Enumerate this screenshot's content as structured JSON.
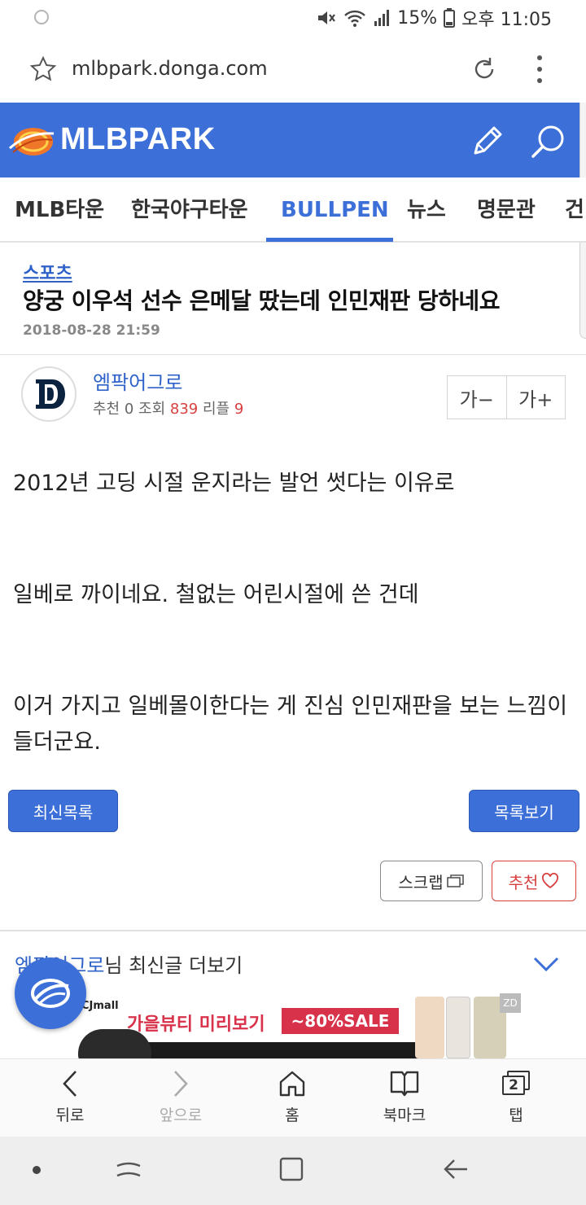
{
  "status_bar": {
    "battery": "15%",
    "time": "오후 11:05"
  },
  "address_bar": {
    "url": "mlbpark.donga.com"
  },
  "site": {
    "logo_text": "MLBPARK"
  },
  "nav_tabs": [
    {
      "label": "MLB타운",
      "active": false
    },
    {
      "label": "한국야구타운",
      "active": false
    },
    {
      "label": "BULLPEN",
      "active": true
    },
    {
      "label": "뉴스",
      "active": false
    },
    {
      "label": "명문관",
      "active": false
    },
    {
      "label": "건",
      "active": false
    }
  ],
  "article": {
    "category": "스포츠",
    "title": "양궁 이우석 선수 은메달 땄는데 인민재판 당하네요",
    "date": "2018-08-28 21:59",
    "author": "엠팍어그로",
    "stats": {
      "recommend_label": "추천",
      "recommend": "0",
      "views_label": "조회",
      "views": "839",
      "replies_label": "리플",
      "replies": "9"
    },
    "font_minus": "가−",
    "font_plus": "가+",
    "paragraphs": [
      "2012년 고딩 시절 운지라는 발언 썻다는 이유로",
      "일베로 까이네요. 철없는 어린시절에 쓴 건데",
      "이거 가지고 일베몰이한다는 게 진심 인민재판을 보는 느낌이 들더군요."
    ]
  },
  "buttons": {
    "latest_list": "최신목록",
    "view_list": "목록보기",
    "scrap": "스크랩",
    "recommend": "추천"
  },
  "more_posts": {
    "author": "엠팍어그로",
    "suffix": "님 최신글 더보기"
  },
  "ad": {
    "brand": "CJmall",
    "headline": "가을뷰티 미리보기",
    "sale": "~80%SALE",
    "badge": "ZD"
  },
  "toolbar": {
    "back": "뒤로",
    "forward": "앞으로",
    "home": "홈",
    "bookmarks": "북마크",
    "tabs": "탭",
    "tab_count": "2"
  },
  "colors": {
    "brand_blue": "#3c6fd8",
    "link_blue": "#2f62c9",
    "accent_red": "#d84040"
  }
}
